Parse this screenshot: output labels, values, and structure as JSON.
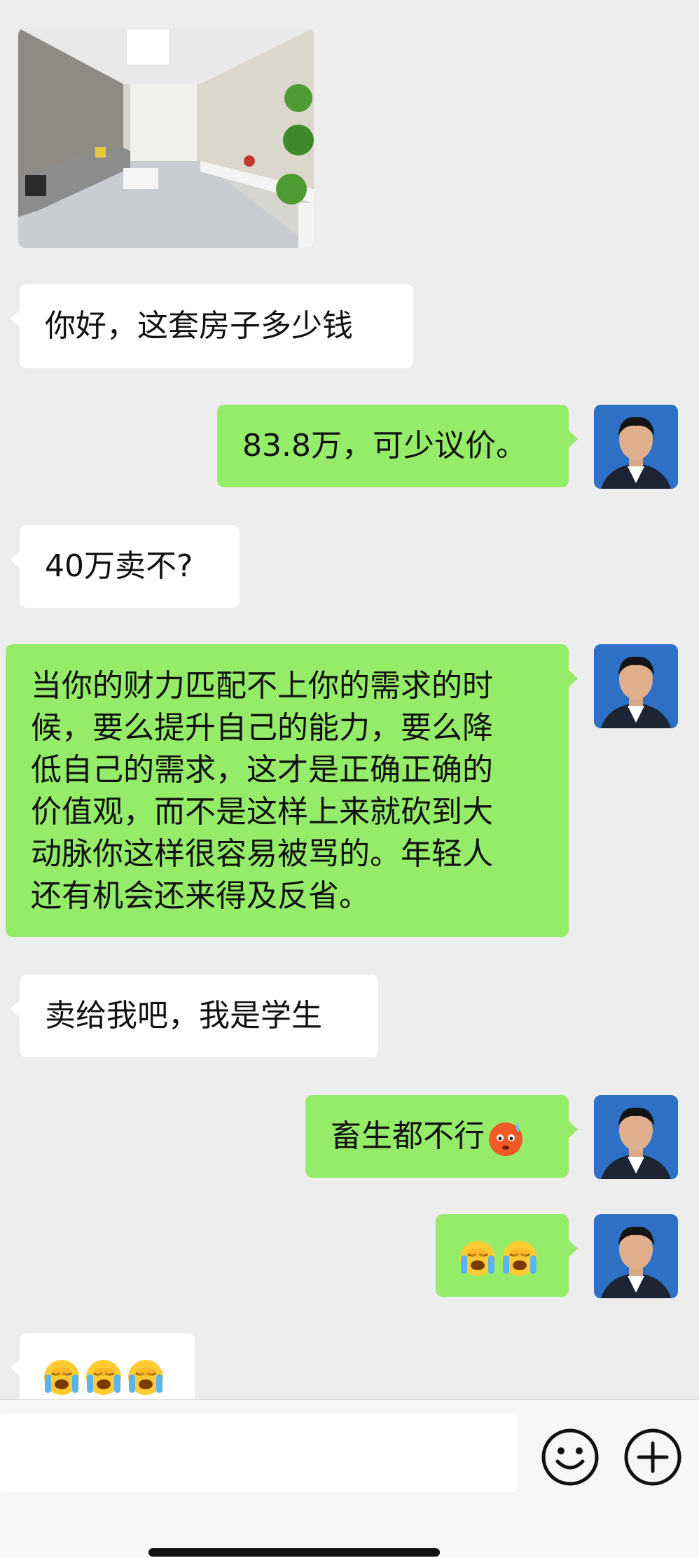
{
  "messages": [
    {
      "type": "image",
      "from": "other",
      "content": "room-photo"
    },
    {
      "type": "text",
      "from": "other",
      "text": "你好，这套房子多少钱"
    },
    {
      "type": "text",
      "from": "me",
      "text": "83.8万，可少议价。"
    },
    {
      "type": "text",
      "from": "other",
      "text": "40万卖不?"
    },
    {
      "type": "text",
      "from": "me",
      "text": "当你的财力匹配不上你的需求的时候，要么提升自己的能力，要么降低自己的需求，这才是正确正确的价值观，而不是这样上来就砍到大动脉你这样很容易被骂的。年轻人还有机会还来得及反省。"
    },
    {
      "type": "text",
      "from": "other",
      "text": "卖给我吧，我是学生"
    },
    {
      "type": "text+emoji",
      "from": "me",
      "text": "畜生都不行",
      "emoji": [
        "hot-face-emoji"
      ]
    },
    {
      "type": "emoji",
      "from": "me",
      "emoji": [
        "loudly-crying-face-emoji",
        "loudly-crying-face-emoji"
      ]
    },
    {
      "type": "emoji",
      "from": "other",
      "emoji": [
        "loudly-crying-face-emoji",
        "loudly-crying-face-emoji",
        "loudly-crying-face-emoji"
      ]
    }
  ],
  "long_message_lines": [
    "当你的财力匹配不上你的需求的时",
    "候，要么提升自己的能力，要么降",
    "低自己的需求，这才是正确正确的",
    "价值观，而不是这样上来就砍到大",
    "动脉你这样很容易被骂的。年轻人",
    "还有机会还来得及反省。"
  ],
  "input_bar": {
    "icons": [
      "emoji-icon",
      "plus-icon"
    ]
  },
  "colors": {
    "background": "#ededed",
    "incoming_bubble": "#ffffff",
    "outgoing_bubble": "#95ec69",
    "avatar_background": "#2e70c6"
  }
}
